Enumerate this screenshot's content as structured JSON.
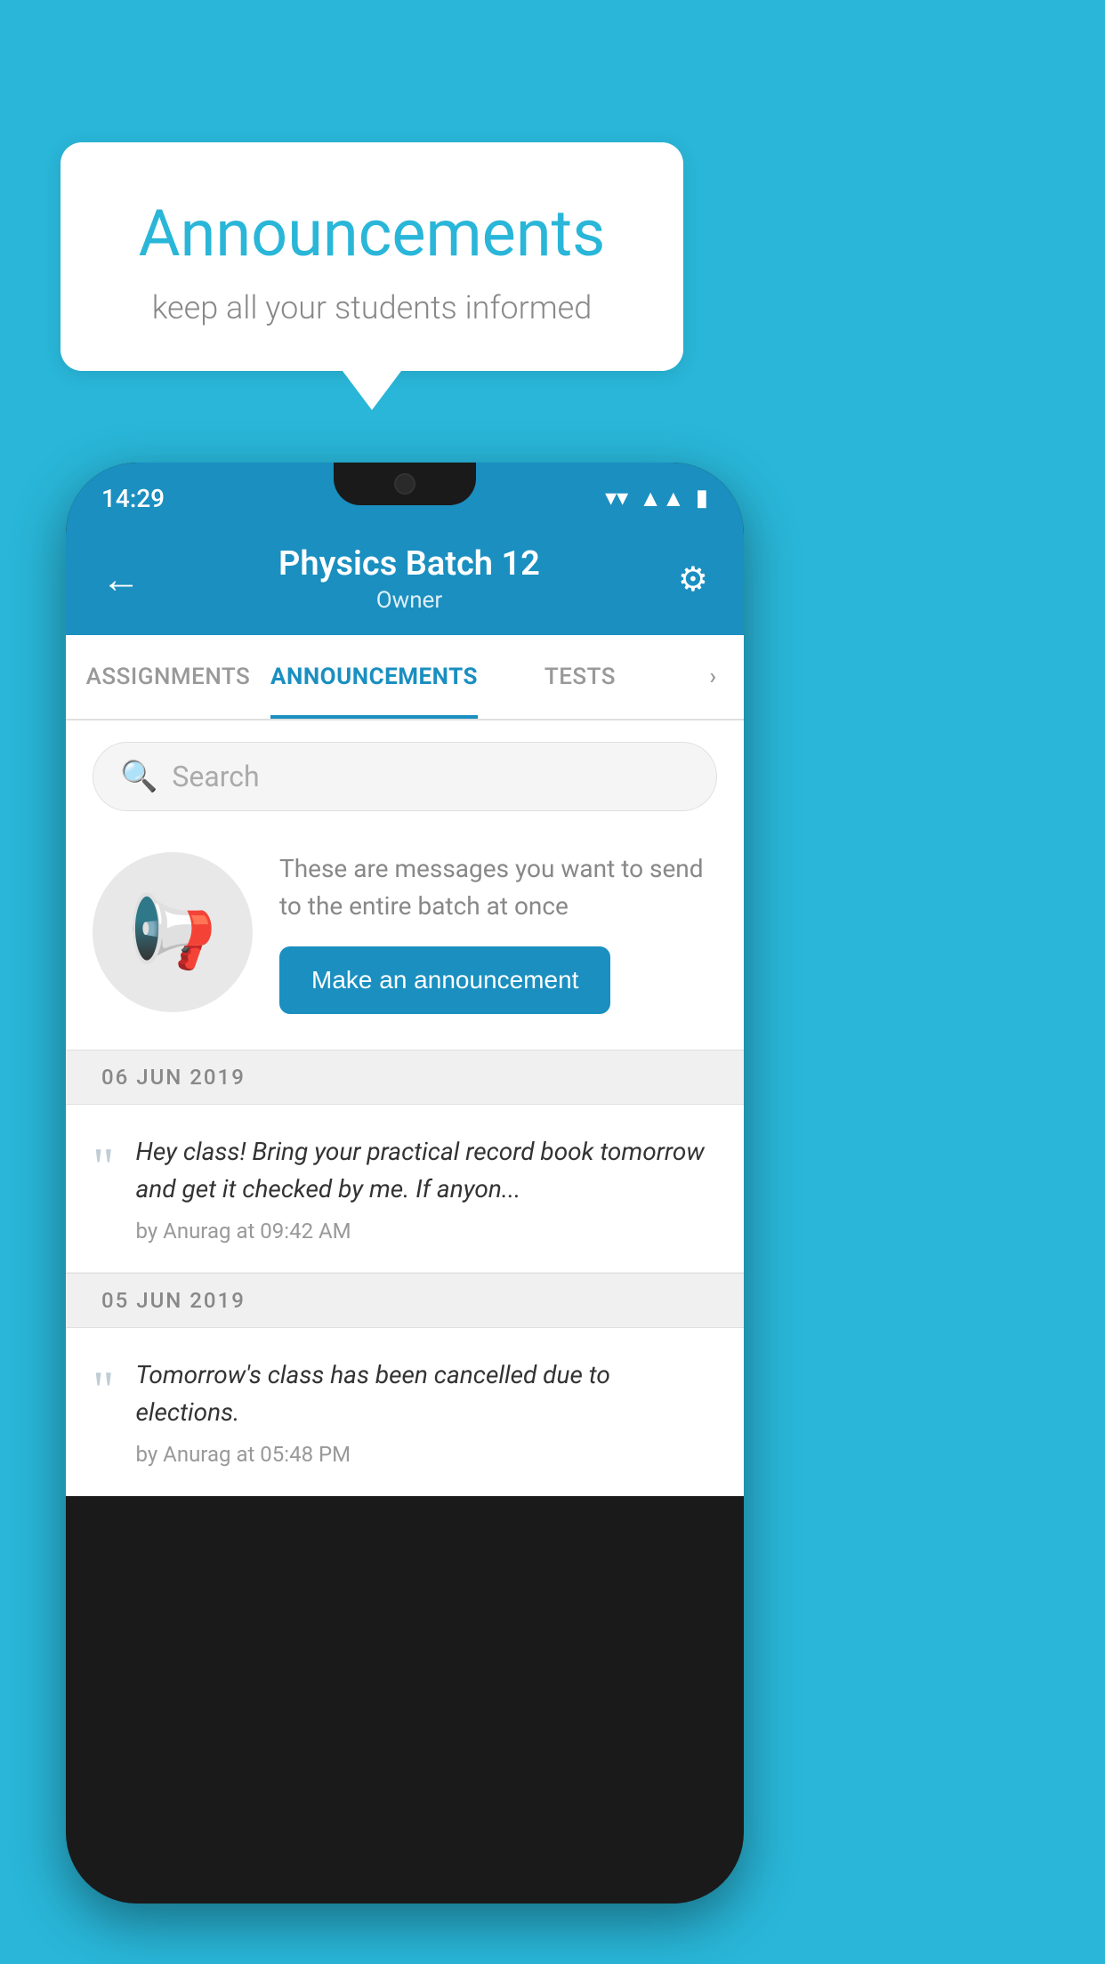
{
  "background_color": "#29b6d8",
  "speech_bubble": {
    "title": "Announcements",
    "subtitle": "keep all your students informed"
  },
  "status_bar": {
    "time": "14:29",
    "wifi_icon": "▼",
    "signal_icon": "▲",
    "battery_icon": "▮"
  },
  "app_header": {
    "back_arrow": "←",
    "title": "Physics Batch 12",
    "subtitle": "Owner",
    "settings_icon": "⚙"
  },
  "tabs": [
    {
      "label": "ASSIGNMENTS",
      "active": false
    },
    {
      "label": "ANNOUNCEMENTS",
      "active": true
    },
    {
      "label": "TESTS",
      "active": false
    },
    {
      "label": "›",
      "active": false
    }
  ],
  "search": {
    "placeholder": "Search"
  },
  "announcement_prompt": {
    "description": "These are messages you want to send to the entire batch at once",
    "button_label": "Make an announcement"
  },
  "date_sections": [
    {
      "date": "06  JUN  2019",
      "announcements": [
        {
          "text": "Hey class! Bring your practical record book tomorrow and get it checked by me. If anyon...",
          "meta": "by Anurag at 09:42 AM"
        }
      ]
    },
    {
      "date": "05  JUN  2019",
      "announcements": [
        {
          "text": "Tomorrow's class has been cancelled due to elections.",
          "meta": "by Anurag at 05:48 PM"
        }
      ]
    }
  ]
}
